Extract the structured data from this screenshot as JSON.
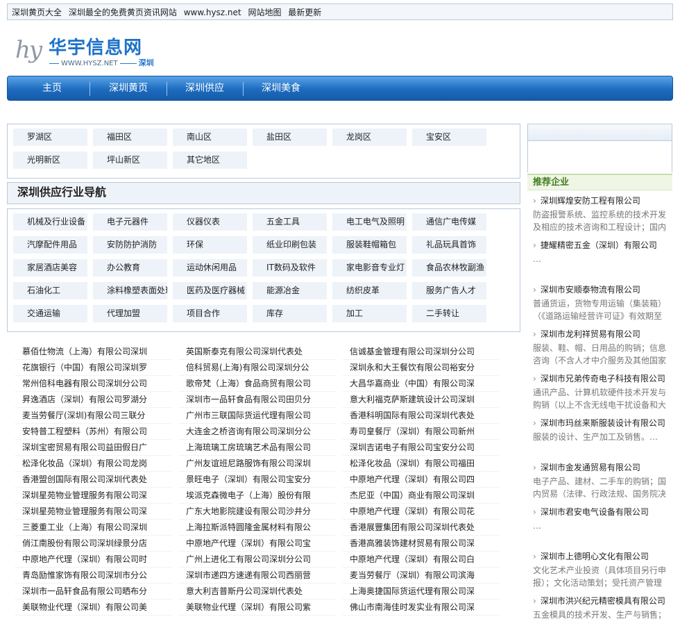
{
  "topbar": {
    "items": [
      "深圳黄页大全",
      "深圳最全的免费黄页资讯网站",
      "www.hysz.net",
      "网站地图",
      "最新更新"
    ]
  },
  "logo": {
    "mark": "hy",
    "name": "华宇信息网",
    "url": "WWW.HYSZ.NET",
    "city": "深圳"
  },
  "nav": {
    "items": [
      "主页",
      "深圳黄页",
      "深圳供应",
      "深圳美食"
    ]
  },
  "districts": [
    "罗湖区",
    "福田区",
    "南山区",
    "盐田区",
    "龙岗区",
    "宝安区",
    "光明新区",
    "坪山新区",
    "其它地区"
  ],
  "section_title": "深圳供应行业导航",
  "industries": [
    "机械及行业设备",
    "电子元器件",
    "仪器仪表",
    "五金工具",
    "电工电气及照明",
    "通信广电传媒",
    "汽摩配件用品",
    "安防防护消防",
    "环保",
    "纸业印刷包装",
    "服装鞋帽箱包",
    "礼品玩具首饰",
    "家居酒店美容",
    "办公教育",
    "运动休闲用品",
    "IT数码及软件",
    "家电影音专业灯",
    "食品农林牧副渔",
    "石油化工",
    "涂料橡塑表面处理",
    "医药及医疗器械",
    "能源冶金",
    "纺织皮革",
    "服务广告人才",
    "交通运输",
    "代理加盟",
    "项目合作",
    "库存",
    "加工",
    "二手转让"
  ],
  "companies": [
    [
      "慕佰仕物流（上海）有限公司深圳",
      "英国斯泰克有限公司深圳代表处",
      "信诚基金管理有限公司深圳分公司"
    ],
    [
      "花旗银行（中国）有限公司深圳罗",
      "倍科贸易(上海)有限公司深圳分公",
      "深圳永和大王餐饮有限公司裕安分"
    ],
    [
      "常州倍科电器有限公司深圳分公司",
      "歌帝梵（上海）食品商贸有限公司",
      "大昌华嘉商业（中国）有限公司深"
    ],
    [
      "昇逸酒店（深圳）有限公司罗湖分",
      "深圳市一品轩食品有限公司田贝分",
      "意大利福克萨斯建筑设计公司深圳"
    ],
    [
      "麦当劳餐厅(深圳)有限公司三联分",
      "广州市三联国际货运代理有限公司",
      "香港科明国际有限公司深圳代表处"
    ],
    [
      "安特普工程塑料（苏州）有限公司",
      "大连金之桥咨询有限公司深圳分公",
      "寿司皇餐厅（深圳）有限公司新州"
    ],
    [
      "深圳宝密贸易有限公司益田假日广",
      "上海琉璃工房琉璃艺术品有限公司",
      "深圳吉诺电子有限公司宝安分公司"
    ],
    [
      "松泽化妆品（深圳）有限公司龙岗",
      "广州友谊班尼路服饰有限公司深圳",
      "松泽化妆品（深圳）有限公司福田"
    ],
    [
      "香港盟创国际有限公司深圳代表处",
      "景旺电子（深圳）有限公司宝安分",
      "中原地产代理（深圳）有限公司四"
    ],
    [
      "深圳星苑物业管理服务有限公司深",
      "埃派克森微电子（上海）股份有限",
      "杰尼亚（中国）商业有限公司深圳"
    ],
    [
      "深圳星苑物业管理服务有限公司深",
      "广东大地影院建设有限公司沙井分",
      "中原地产代理（深圳）有限公司花"
    ],
    [
      "三菱重工业（上海）有限公司深圳",
      "上海拉斯派特圆隆金属材料有限公",
      "香港展豐集团有限公司深圳代表处"
    ],
    [
      "俏江南股份有限公司深圳绿景分店",
      "中原地产代理（深圳）有限公司宝",
      "香港高雅装饰建材贸易有限公司深"
    ],
    [
      "中原地产代理（深圳）有限公司时",
      "广州上进化工有限公司深圳分公司",
      "中原地产代理（深圳）有限公司白"
    ],
    [
      "青岛励惟家饰有限公司深圳市分公",
      "深圳市递四方速递有限公司西丽营",
      "麦当劳餐厅（深圳）有限公司滨海"
    ],
    [
      "深圳市一品轩食品有限公司晒布分",
      "意大利吉普斯丹公司深圳代表处",
      "上海奥捷国际货运代理有限公司深"
    ],
    [
      "美联物业代理（深圳）有限公司美",
      "美联物业代理（深圳）有限公司紫",
      "佛山市南海佳时发实业有限公司深"
    ]
  ],
  "recommend": {
    "title": "推荐企业",
    "items": [
      {
        "name": "深圳辉煌安防工程有限公司",
        "desc": "防盗报警系统、监控系统的技术开发及相应的技术咨询和工程设计；国内"
      },
      {
        "name": "捷耀精密五金（深圳）有限公司",
        "desc": "…"
      },
      {
        "name": "深圳市安顺泰物流有限公司",
        "desc": "普通货运，货物专用运输（集装箱）（《道路运输经营许可证》有效期至"
      },
      {
        "name": "深圳市龙利祥贸易有限公司",
        "desc": "服装、鞋、帽、日用品的购销；信息咨询（不含人才中介服务及其他国家"
      },
      {
        "name": "深圳市兄弟传奇电子科技有限公司",
        "desc": "通讯产品、计算机软硬件技术开发与购销（以上不含无线电干扰设备和大"
      },
      {
        "name": "深圳市玛丝来斯服装设计有限公司",
        "desc": "服装的设计、生产加工及销售。…"
      },
      {
        "name": "深圳市金发通贸易有限公司",
        "desc": "电子产品、建材、二手车的购销；国内贸易（法律、行政法规、国务院决"
      },
      {
        "name": "深圳市君安电气设备有限公司",
        "desc": "…"
      },
      {
        "name": "深圳市上德明心文化有限公司",
        "desc": "文化艺术产业投资（具体项目另行申报）；文化活动策划；受托资产管理"
      },
      {
        "name": "深圳市洪兴纪元精密模具有限公司",
        "desc": "五金模具的技术开发、生产与销售；"
      }
    ]
  }
}
